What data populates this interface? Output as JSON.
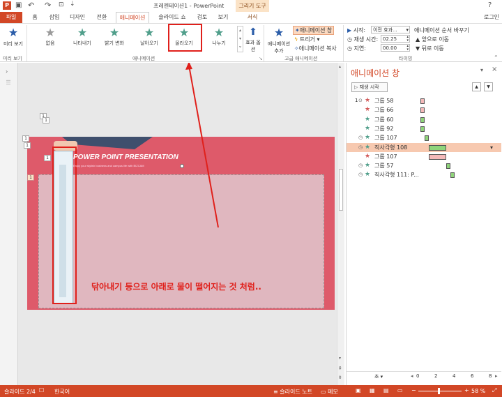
{
  "titlebar": {
    "title": "프레젠테이션1 - PowerPoint",
    "context_group": "그리기 도구"
  },
  "tabs": [
    {
      "label": "파일"
    },
    {
      "label": "홈"
    },
    {
      "label": "삽입"
    },
    {
      "label": "디자인"
    },
    {
      "label": "전환"
    },
    {
      "label": "애니메이션"
    },
    {
      "label": "슬라이드 쇼"
    },
    {
      "label": "검토"
    },
    {
      "label": "보기"
    },
    {
      "label": "서식"
    }
  ],
  "account": "로그인",
  "ribbon": {
    "preview_label": "미리 보기",
    "preview_group": "미리 보기",
    "animation_group": "애니메이션",
    "advanced_group": "고급 애니메이션",
    "timing_group": "타이밍",
    "gallery": [
      {
        "label": "없음",
        "color": "#9a9a9a"
      },
      {
        "label": "나타내기",
        "color": "#4f9e8a"
      },
      {
        "label": "밝기 변화",
        "color": "#4f9e8a"
      },
      {
        "label": "날아오기",
        "color": "#4f9e8a"
      },
      {
        "label": "올라오기",
        "color": "#4f9e8a"
      },
      {
        "label": "나누기",
        "color": "#4f9e8a"
      }
    ],
    "effect_options": "효과 옵션",
    "add_animation": "애니메이션 추가",
    "animation_pane_btn": "애니메이션 창",
    "trigger": "트리거",
    "anim_painter": "애니메이션 복사",
    "start_label": "시작:",
    "start_value": "이전 효과...",
    "duration_label": "재생 시간:",
    "duration_value": "02.25",
    "delay_label": "지연:",
    "delay_value": "00.00",
    "reorder_label": "애니메이션 순서 바꾸기",
    "move_earlier": "앞으로 이동",
    "move_later": "뒤로 이동"
  },
  "slide": {
    "title": "POWER POINT PRESENTATION",
    "subtitle": "Enjoy your stylish business and campus life with BIZCAM",
    "annotation": "닦아내기 등으로 아래로 물이 떨어지는 것 처럼..",
    "tags": [
      "1",
      "1",
      "1",
      "1",
      "1",
      "1"
    ]
  },
  "anipane": {
    "title": "애니메이션 창",
    "play_button": "재생 시작",
    "items": [
      {
        "num": "1",
        "name": "그룹 58",
        "star_color": "#d25a5a",
        "bar_color": "#f4b9b9",
        "bar_offset": 0.02,
        "bar_len": 0.06,
        "selected": false
      },
      {
        "num": "",
        "name": "그룹 66",
        "star_color": "#d25a5a",
        "bar_color": "#f4b9b9",
        "bar_offset": 0.02,
        "bar_len": 0.06,
        "selected": false
      },
      {
        "num": "",
        "name": "그룹 60",
        "star_color": "#4f9e8a",
        "bar_color": "#8fd47a",
        "bar_offset": 0.02,
        "bar_len": 0.06,
        "selected": false
      },
      {
        "num": "",
        "name": "그룹 92",
        "star_color": "#4f9e8a",
        "bar_color": "#8fd47a",
        "bar_offset": 0.02,
        "bar_len": 0.06,
        "selected": false
      },
      {
        "num": "",
        "name": "그룹 107",
        "star_color": "#4f9e8a",
        "bar_color": "#8fd47a",
        "bar_offset": 0.08,
        "bar_len": 0.06,
        "selected": false
      },
      {
        "num": "",
        "name": "직사각형 108",
        "star_color": "#4f9e8a",
        "bar_color": "#8fd47a",
        "bar_offset": 0.14,
        "bar_len": 0.25,
        "selected": true
      },
      {
        "num": "",
        "name": "그룹 107",
        "star_color": "#d25a5a",
        "bar_color": "#f4b9b9",
        "bar_offset": 0.14,
        "bar_len": 0.25,
        "selected": false
      },
      {
        "num": "",
        "name": "그룹 57",
        "star_color": "#4f9e8a",
        "bar_color": "#8fd47a",
        "bar_offset": 0.39,
        "bar_len": 0.06,
        "selected": false
      },
      {
        "num": "",
        "name": "직사각형 111: P...",
        "star_color": "#4f9e8a",
        "bar_color": "#8fd47a",
        "bar_offset": 0.45,
        "bar_len": 0.06,
        "selected": false
      }
    ],
    "timeline_label": "초",
    "timeline_ticks": [
      "0",
      "2",
      "4",
      "6",
      "8"
    ]
  },
  "status": {
    "slide_pos": "슬라이드 2/4",
    "language": "한국어",
    "notes": "슬라이드 노트",
    "comments": "메모",
    "zoom": "58 %"
  }
}
